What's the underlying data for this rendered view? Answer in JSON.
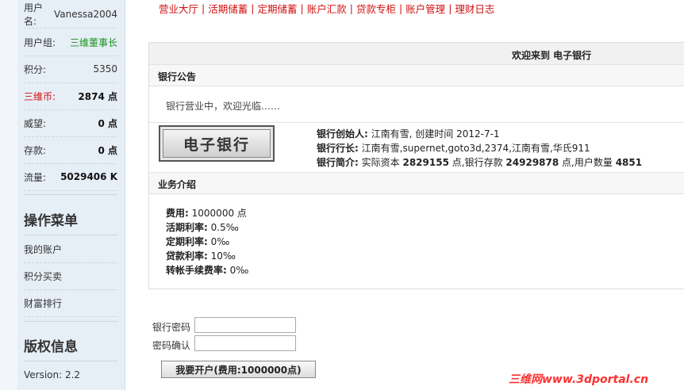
{
  "user": {
    "name_label": "用户名:",
    "name_value": "Vanessa2004",
    "group_label": "用户组:",
    "group_value": "三维董事长",
    "points_label": "积分:",
    "points_value": "5350",
    "coins_label": "三维币:",
    "coins_value": "2874 点",
    "prestige_label": "威望:",
    "prestige_value": "0 点",
    "deposit_label": "存款:",
    "deposit_value": "0 点",
    "traffic_label": "流量:",
    "traffic_value": "5029406 K"
  },
  "menu": {
    "title": "操作菜单",
    "items": [
      "我的账户",
      "积分买卖",
      "财富排行"
    ]
  },
  "copyright": {
    "title": "版权信息",
    "version": "Version: 2.2"
  },
  "nav": {
    "items": [
      "营业大厅",
      "活期储蓄",
      "定期储蓄",
      "账户汇款",
      "贷款专柜",
      "账户管理",
      "理财日志"
    ]
  },
  "main": {
    "welcome": "欢迎来到 电子银行",
    "notice_title": "银行公告",
    "notice_text": "银行营业中，欢迎光临……",
    "logo_text": "电子银行",
    "founder_label": "银行创始人:",
    "founder_value": "江南有雪, 创建时间 2012-7-1",
    "president_label": "银行行长:",
    "president_value": "江南有雪,supernet,goto3d,2374,江南有雪,华氏911",
    "intro_label": "银行简介:",
    "intro_prefix": "实际资本",
    "capital": "2829155",
    "intro_mid1": "点,银行存款",
    "bank_deposit": "24929878",
    "intro_mid2": "点,用户数量",
    "user_count": "4851",
    "biz_title": "业务介绍",
    "fee_label": "费用:",
    "fee_value": "1000000 点",
    "current_rate_label": "活期利率:",
    "current_rate_value": "0.5‰",
    "fixed_rate_label": "定期利率:",
    "fixed_rate_value": "0‰",
    "loan_rate_label": "贷款利率:",
    "loan_rate_value": "10‰",
    "transfer_fee_label": "转帐手续费率:",
    "transfer_fee_value": "0‰"
  },
  "form": {
    "password_label": "银行密码",
    "password_value": "",
    "confirm_label": "密码确认",
    "confirm_value": "",
    "submit_label": "我要开户(费用:1000000点)"
  },
  "watermark": "三维网www.3dportal.cn",
  "colors": {
    "nav_red": "#d01010",
    "group_green": "#1c8f1c",
    "panel_bg": "#e6eef6"
  }
}
